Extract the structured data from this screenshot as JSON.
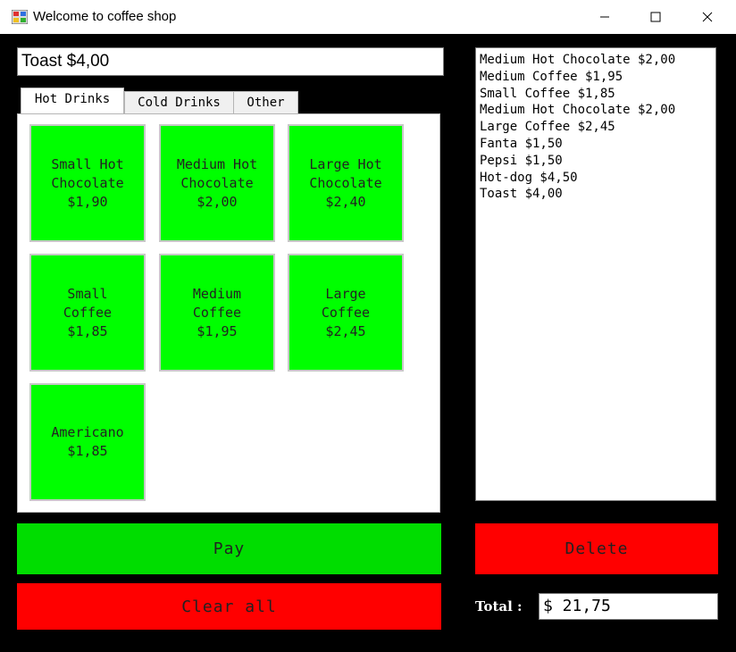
{
  "window": {
    "title": "Welcome to coffee shop",
    "minimize_glyph": "—",
    "maximize_glyph": "☐",
    "close_glyph": "✕"
  },
  "selected_item": "Toast $4,00",
  "tabs": [
    {
      "label": "Hot Drinks",
      "active": true
    },
    {
      "label": "Cold Drinks",
      "active": false
    },
    {
      "label": "Other",
      "active": false
    }
  ],
  "hot_drinks": [
    {
      "label": "Small Hot\nChocolate\n$1,90"
    },
    {
      "label": "Medium Hot\nChocolate\n$2,00"
    },
    {
      "label": "Large Hot\nChocolate\n$2,40"
    },
    {
      "label": "Small\nCoffee\n$1,85"
    },
    {
      "label": "Medium\nCoffee\n$1,95"
    },
    {
      "label": "Large\nCoffee\n$2,45"
    },
    {
      "label": "Americano\n$1,85"
    }
  ],
  "order_items": [
    "Medium Hot Chocolate $2,00",
    "Medium Coffee $1,95",
    "Small Coffee $1,85",
    "Medium Hot Chocolate $2,00",
    "Large Coffee $2,45",
    "Fanta $1,50",
    "Pepsi $1,50",
    "Hot-dog $4,50",
    "Toast $4,00"
  ],
  "buttons": {
    "pay": "Pay",
    "clear_all": "Clear all",
    "delete": "Delete"
  },
  "total": {
    "label": "Total :",
    "value": "$ 21,75"
  },
  "colors": {
    "item_green": "#00ff00",
    "pay_green": "#00dd00",
    "red": "#ff0000"
  }
}
